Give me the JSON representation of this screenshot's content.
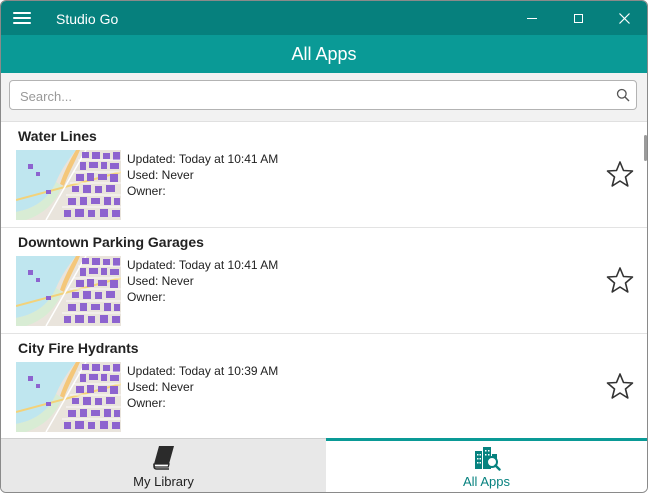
{
  "titlebar": {
    "app_name": "Studio Go",
    "icons": [
      "hamburger-menu-icon",
      "minimize-icon",
      "maximize-icon",
      "close-icon"
    ]
  },
  "header": {
    "title": "All Apps"
  },
  "search": {
    "placeholder": "Search...",
    "value": "",
    "icon": "search-icon"
  },
  "apps": [
    {
      "title": "Water Lines",
      "updated": "Updated: Today at 10:41 AM",
      "used": "Used: Never",
      "owner": "Owner:"
    },
    {
      "title": "Downtown Parking Garages",
      "updated": "Updated: Today at 10:41 AM",
      "used": "Used: Never",
      "owner": "Owner:"
    },
    {
      "title": "City Fire Hydrants",
      "updated": "Updated: Today at 10:39 AM",
      "used": "Used: Never",
      "owner": "Owner:"
    }
  ],
  "nav": {
    "library": {
      "label": "My Library",
      "icon": "book-icon"
    },
    "all_apps": {
      "label": "All Apps",
      "icon": "city-search-icon",
      "selected": true
    }
  },
  "colors": {
    "titlebar": "#06807d",
    "header": "#0a9a96",
    "accent": "#07827f",
    "map_water": "#bfe6ef",
    "map_buildings": "#8d63cf"
  }
}
